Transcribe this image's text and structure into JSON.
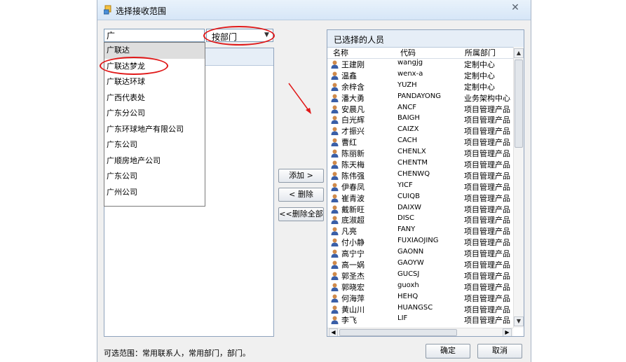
{
  "window": {
    "title": "选择接收范围",
    "close_glyph": "✕"
  },
  "search": {
    "value": "广"
  },
  "filter": {
    "value": "按部门",
    "arrow": "▼"
  },
  "dropdown": {
    "items": [
      "广联达",
      "广联达梦龙",
      "广联达环球",
      "广西代表处",
      "广东分公司",
      "广东环球地产有限公司",
      "广东公司",
      "广顺房地产公司",
      "广东公司",
      "广州公司"
    ],
    "highlighted_index": 0,
    "circled_index": 1
  },
  "buttons": {
    "add": "添加 >",
    "remove": "< 删除",
    "remove_all": "<<删除全部",
    "ok": "确定",
    "cancel": "取消"
  },
  "selected": {
    "title": "已选择的人员",
    "columns": {
      "name": "名称",
      "code": "代码",
      "dept": "所属部门"
    },
    "rows": [
      {
        "name": "王建刚",
        "code": "wangjg",
        "dept": "定制中心"
      },
      {
        "name": "温鑫",
        "code": "wenx-a",
        "dept": "定制中心"
      },
      {
        "name": "余梓含",
        "code": "YUZH",
        "dept": "定制中心"
      },
      {
        "name": "潘大勇",
        "code": "PANDAYONG",
        "dept": "业务架构中心"
      },
      {
        "name": "安晨凡",
        "code": "ANCF",
        "dept": "项目管理产品"
      },
      {
        "name": "白光辉",
        "code": "BAIGH",
        "dept": "项目管理产品"
      },
      {
        "name": "才振兴",
        "code": "CAIZX",
        "dept": "项目管理产品"
      },
      {
        "name": "曹红",
        "code": "CACH",
        "dept": "项目管理产品"
      },
      {
        "name": "陈丽新",
        "code": "CHENLX",
        "dept": "项目管理产品"
      },
      {
        "name": "陈天梅",
        "code": "CHENTM",
        "dept": "项目管理产品"
      },
      {
        "name": "陈伟强",
        "code": "CHENWQ",
        "dept": "项目管理产品"
      },
      {
        "name": "伊春凤",
        "code": "YICF",
        "dept": "项目管理产品"
      },
      {
        "name": "崔青波",
        "code": "CUIQB",
        "dept": "项目管理产品"
      },
      {
        "name": "戴新旺",
        "code": "DAIXW",
        "dept": "项目管理产品"
      },
      {
        "name": "底淑超",
        "code": "DISC",
        "dept": "项目管理产品"
      },
      {
        "name": "凡亮",
        "code": "FANY",
        "dept": "项目管理产品"
      },
      {
        "name": "付小静",
        "code": "FUXIAOJING",
        "dept": "项目管理产品"
      },
      {
        "name": "高宁宁",
        "code": "GAONN",
        "dept": "项目管理产品"
      },
      {
        "name": "高一娲",
        "code": "GAOYW",
        "dept": "项目管理产品"
      },
      {
        "name": "郭圣杰",
        "code": "GUCSJ",
        "dept": "项目管理产品"
      },
      {
        "name": "郭晓宏",
        "code": "guoxh",
        "dept": "项目管理产品"
      },
      {
        "name": "何海萍",
        "code": "HEHQ",
        "dept": "项目管理产品"
      },
      {
        "name": "黄山川",
        "code": "HUANGSC",
        "dept": "项目管理产品"
      },
      {
        "name": "李飞",
        "code": "LIF",
        "dept": "项目管理产品"
      }
    ]
  },
  "footer": {
    "text": "可选范围：常用联系人，常用部门，部门。"
  },
  "colors": {
    "annotation": "#e01818",
    "title_bar": "#dbe8f7",
    "icon_head": "#d08a4a",
    "icon_body": "#3a5fa8"
  }
}
